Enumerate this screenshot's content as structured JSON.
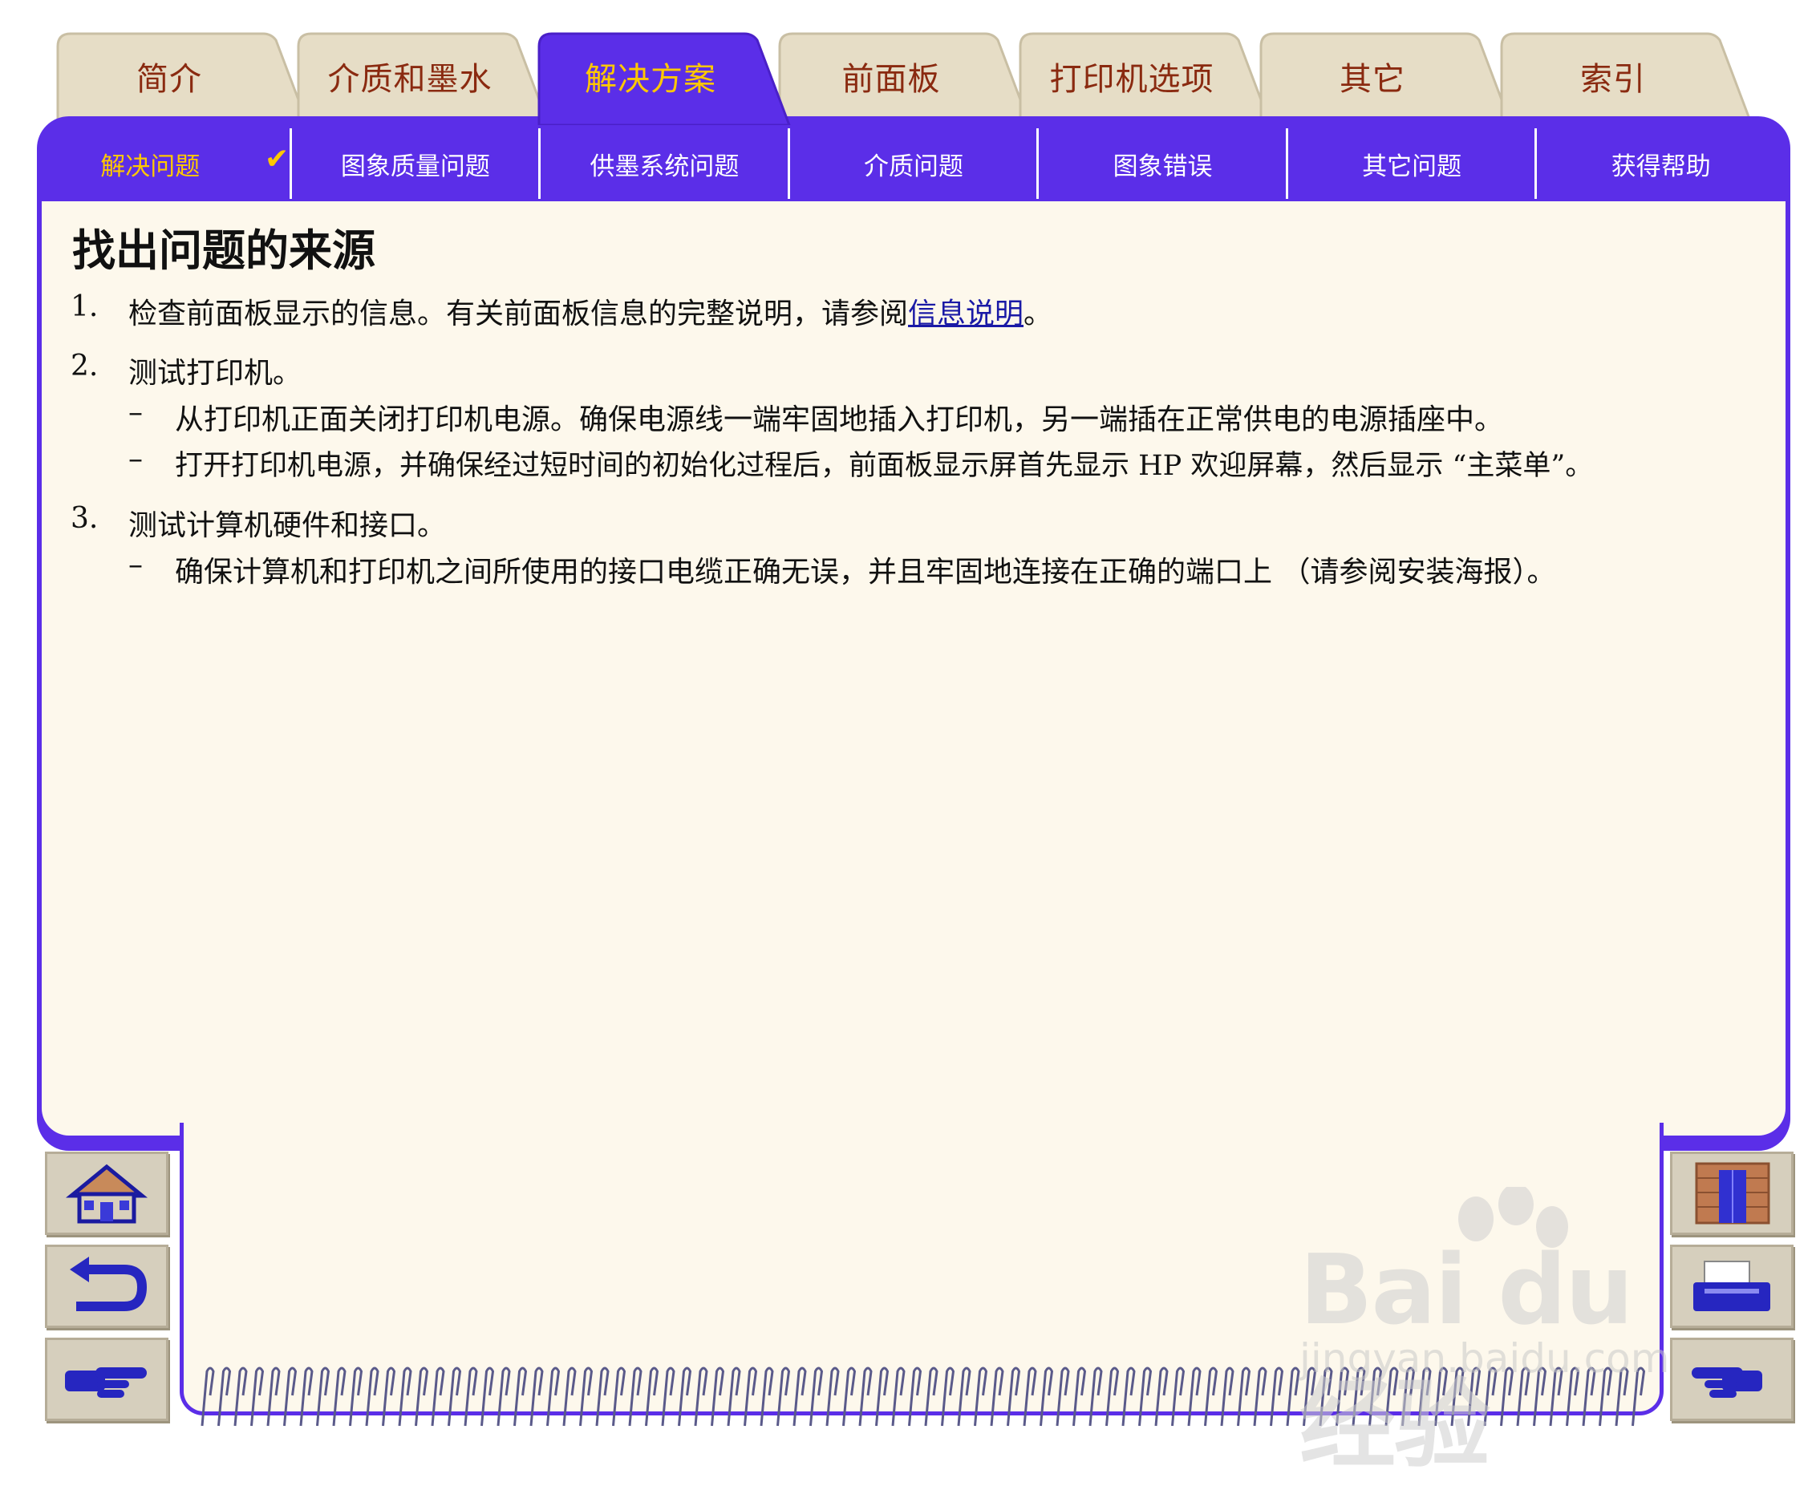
{
  "tabs": [
    "简介",
    "介质和墨水",
    "解决方案",
    "前面板",
    "打印机选项",
    "其它",
    "索引"
  ],
  "active_tab": 2,
  "subnav": [
    "解决问题",
    "图象质量问题",
    "供墨系统问题",
    "介质问题",
    "图象错误",
    "其它问题",
    "获得帮助"
  ],
  "active_subnav": 0,
  "subnav_check": "✔",
  "main": {
    "title": "找出问题的来源",
    "step1": {
      "num": "1.",
      "text": "检查前面板显示的信息。有关前面板信息的完整说明，请参阅",
      "link": "信息说明",
      "after": "。"
    },
    "step2": {
      "num": "2.",
      "text": "测试打印机。",
      "bullets": [
        "从打印机正面关闭打印机电源。确保电源线一端牢固地插入打印机，另一端插在正常供电的电源插座中。",
        "打开打印机电源，并确保经过短时间的初始化过程后，前面板显示屏首先显示 HP 欢迎屏幕，然后显示 “主菜单”。"
      ]
    },
    "step3": {
      "num": "3.",
      "text": "测试计算机硬件和接口。",
      "bullets": [
        "确保计算机和打印机之间所使用的接口电缆正确无误，并且牢固地连接在正确的端口上 （请参阅安装海报）。"
      ]
    },
    "dash": "–"
  },
  "side_buttons": {
    "left": [
      "home-icon",
      "back-icon",
      "forward-hand-icon"
    ],
    "right": [
      "contents-door-icon",
      "print-icon",
      "next-hand-icon"
    ]
  },
  "watermark": {
    "logo": "Bai du 经验",
    "url": "jingyan.baidu.com"
  },
  "colors": {
    "frame": "#5b2ee8",
    "active_text": "#ffc800",
    "tab_text": "#8a2a10",
    "page": "#fdf8ec",
    "tab": "#e6ddc6"
  }
}
